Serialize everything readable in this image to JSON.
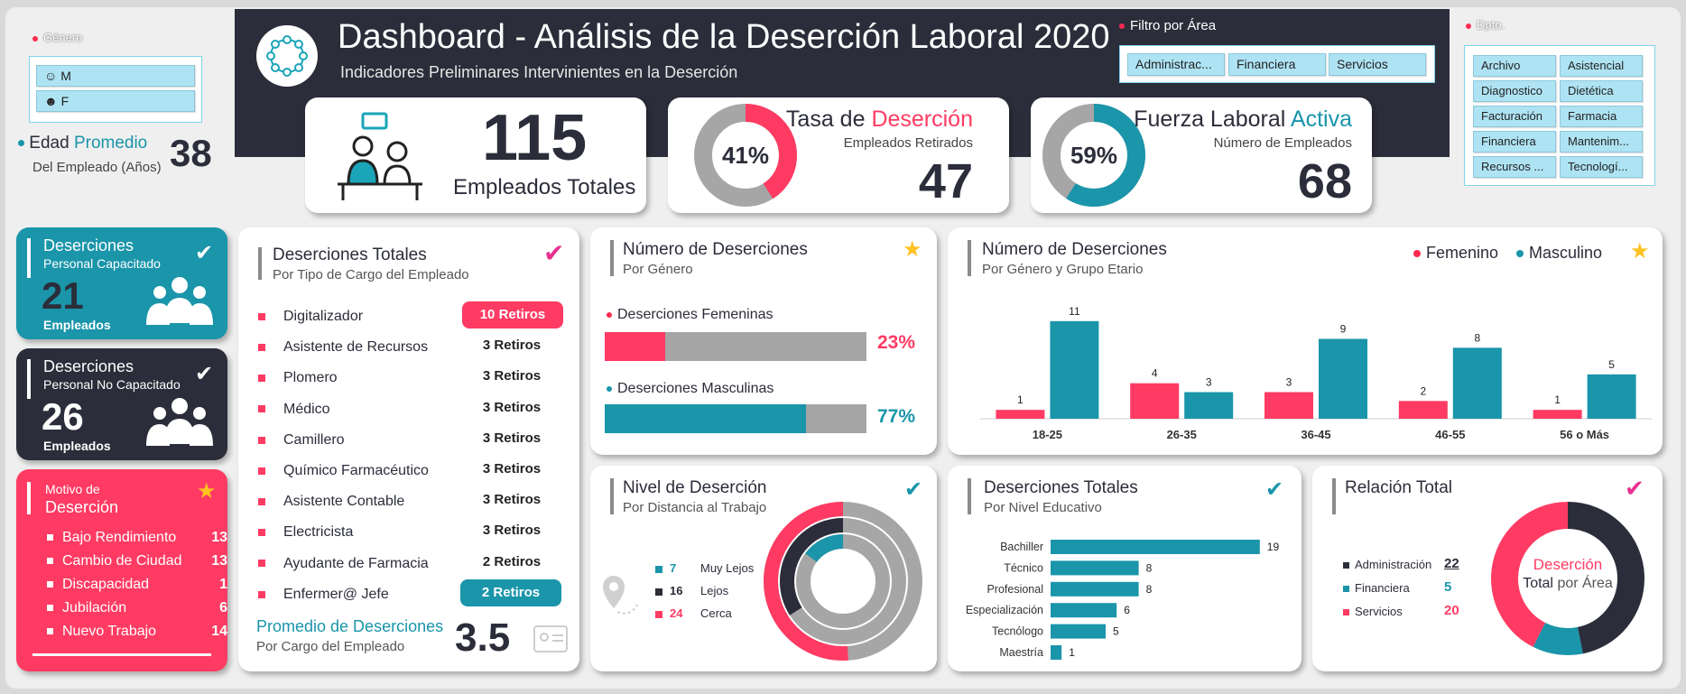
{
  "header": {
    "title": "Dashboard - Análisis de la Deserción Laboral 2020",
    "subtitle": "Indicadores Preliminares Intervinientes en la Deserción"
  },
  "genero": {
    "label": "Género",
    "options": [
      "M",
      "F"
    ]
  },
  "edad": {
    "label_a": "Edad",
    "label_b": "Promedio",
    "sub": "Del Empleado (Años)",
    "value": "38"
  },
  "filtro_area": {
    "label": "Filtro por Área",
    "options": [
      "Administrac...",
      "Financiera",
      "Servicios"
    ]
  },
  "dpto": {
    "label": "Dpto.",
    "options": [
      "Archivo",
      "Asistencial",
      "Diagnostico",
      "Dietética",
      "Facturación",
      "Farmacia",
      "Financiera",
      "Mantenim...",
      "Recursos ...",
      "Tecnologí..."
    ]
  },
  "kpi_total": {
    "value": "115",
    "label": "Empleados Totales"
  },
  "kpi_tasa": {
    "title_a": "Tasa de",
    "title_b": "Deserción",
    "sub": "Empleados Retirados",
    "value": "47",
    "percent": "41%",
    "fraction": 0.41
  },
  "kpi_fuerza": {
    "title_a": "Fuerza Laboral",
    "title_b": "Activa",
    "sub": "Número de Empleados",
    "value": "68",
    "percent": "59%",
    "fraction": 0.59
  },
  "capacitado": {
    "title": "Deserciones",
    "sub": "Personal Capacitado",
    "value": "21",
    "unit": "Empleados"
  },
  "no_capacitado": {
    "title": "Deserciones",
    "sub": "Personal No Capacitado",
    "value": "26",
    "unit": "Empleados"
  },
  "motivo": {
    "title_a": "Motivo de",
    "title_b": "Deserción",
    "items": [
      {
        "label": "Bajo Rendimiento",
        "value": "13"
      },
      {
        "label": "Cambio de Ciudad",
        "value": "13"
      },
      {
        "label": "Discapacidad",
        "value": "1"
      },
      {
        "label": "Jubilación",
        "value": "6"
      },
      {
        "label": "Nuevo Trabajo",
        "value": "14"
      }
    ]
  },
  "cargo": {
    "title": "Deserciones Totales",
    "sub": "Por Tipo de Cargo del Empleado",
    "items": [
      {
        "label": "Digitalizador",
        "value": "10 Retiros"
      },
      {
        "label": "Asistente de Recursos",
        "value": "3 Retiros"
      },
      {
        "label": "Plomero",
        "value": "3 Retiros"
      },
      {
        "label": "Médico",
        "value": "3 Retiros"
      },
      {
        "label": "Camillero",
        "value": "3 Retiros"
      },
      {
        "label": "Químico Farmacéutico",
        "value": "3 Retiros"
      },
      {
        "label": "Asistente Contable",
        "value": "3 Retiros"
      },
      {
        "label": "Electricista",
        "value": "3 Retiros"
      },
      {
        "label": "Ayudante de Farmacia",
        "value": "2 Retiros"
      },
      {
        "label": "Enfermer@ Jefe",
        "value": "2 Retiros"
      }
    ],
    "promedio_title": "Promedio de Deserciones",
    "promedio_sub": "Por Cargo del Empleado",
    "promedio_value": "3.5"
  },
  "genero_chart": {
    "title": "Número de Deserciones",
    "sub": "Por Género",
    "fem_label": "Deserciones Femeninas",
    "fem_percent": "23%",
    "fem_fraction": 0.23,
    "mas_label": "Deserciones Masculinas",
    "mas_percent": "77%",
    "mas_fraction": 0.77
  },
  "edad_chart": {
    "title": "Número de Deserciones",
    "sub": "Por Género y Grupo Etario",
    "legend": [
      "Femenino",
      "Masculino"
    ]
  },
  "distancia": {
    "title": "Nivel de Deserción",
    "sub": "Por Distancia al Trabajo",
    "items": [
      {
        "value": "7",
        "label": "Muy Lejos"
      },
      {
        "value": "16",
        "label": "Lejos"
      },
      {
        "value": "24",
        "label": "Cerca"
      }
    ]
  },
  "educativo": {
    "title": "Deserciones Totales",
    "sub": "Por Nivel Educativo"
  },
  "relacion": {
    "title": "Relación Total",
    "center_a": "Deserción",
    "center_b": "Total",
    "center_c": "por Área",
    "items": [
      {
        "label": "Administración",
        "value": "22"
      },
      {
        "label": "Financiera",
        "value": "5"
      },
      {
        "label": "Servicios",
        "value": "20"
      }
    ]
  },
  "colors": {
    "dark": "#2b2d3a",
    "teal": "#1a95aa",
    "pink": "#ff3b63",
    "grey": "#a6a6a6"
  },
  "chart_data": [
    {
      "type": "bar",
      "title": "Número de Deserciones",
      "subtitle": "Por Género y Grupo Etario",
      "categories": [
        "18-25",
        "26-35",
        "36-45",
        "46-55",
        "56 o Más"
      ],
      "series": [
        {
          "name": "Femenino",
          "values": [
            1,
            4,
            3,
            2,
            1
          ]
        },
        {
          "name": "Masculino",
          "values": [
            11,
            3,
            9,
            8,
            5
          ]
        }
      ],
      "ylim": [
        0,
        12
      ],
      "legend": "top-right",
      "grid": false
    },
    {
      "type": "bar",
      "orientation": "horizontal",
      "title": "Deserciones Totales",
      "subtitle": "Por Nivel Educativo",
      "categories": [
        "Bachiller",
        "Técnico",
        "Profesional",
        "Especialización",
        "Tecnólogo",
        "Maestría"
      ],
      "values": [
        19,
        8,
        8,
        6,
        5,
        1
      ],
      "xlim": [
        0,
        20
      ]
    },
    {
      "type": "pie",
      "title": "Relación Total",
      "labels": [
        "Administración",
        "Financiera",
        "Servicios"
      ],
      "values": [
        22,
        5,
        20
      ]
    },
    {
      "type": "pie",
      "title": "Nivel de Deserción",
      "subtitle": "Por Distancia al Trabajo",
      "labels": [
        "Muy Lejos",
        "Lejos",
        "Cerca"
      ],
      "values": [
        7,
        16,
        24
      ]
    }
  ]
}
